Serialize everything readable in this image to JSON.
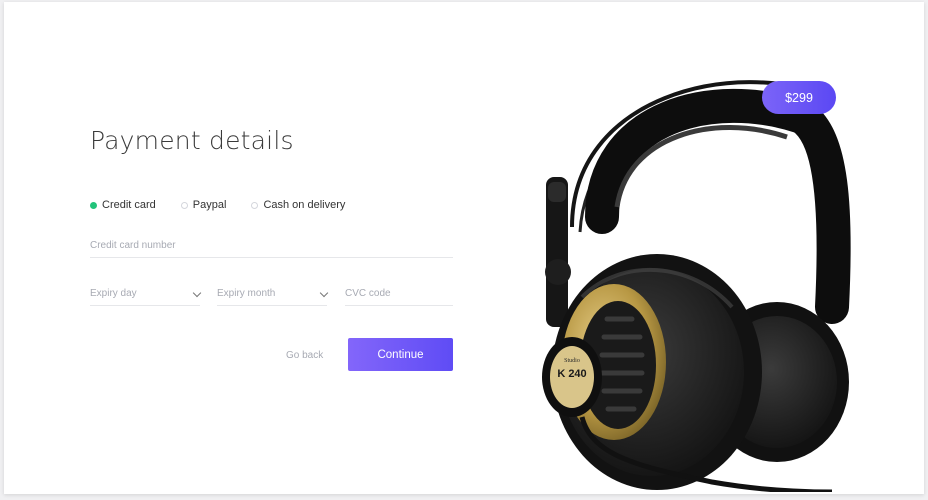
{
  "page": {
    "title": "Payment details"
  },
  "payment_methods": [
    {
      "label": "Credit card",
      "selected": true
    },
    {
      "label": "Paypal",
      "selected": false
    },
    {
      "label": "Cash on delivery",
      "selected": false
    }
  ],
  "fields": {
    "card_number": {
      "placeholder": "Credit card number",
      "value": ""
    },
    "expiry_day": {
      "placeholder": "Expiry day",
      "value": ""
    },
    "expiry_month": {
      "placeholder": "Expiry month",
      "value": ""
    },
    "cvc": {
      "placeholder": "CVC code",
      "value": ""
    }
  },
  "actions": {
    "go_back": "Go back",
    "continue": "Continue"
  },
  "product": {
    "price": "$299",
    "image_icon": "headphones-image",
    "cup_labels": [
      "K 240",
      "Studio"
    ]
  },
  "colors": {
    "accent": "#6a56f6",
    "selected_radio": "#22c37a"
  }
}
